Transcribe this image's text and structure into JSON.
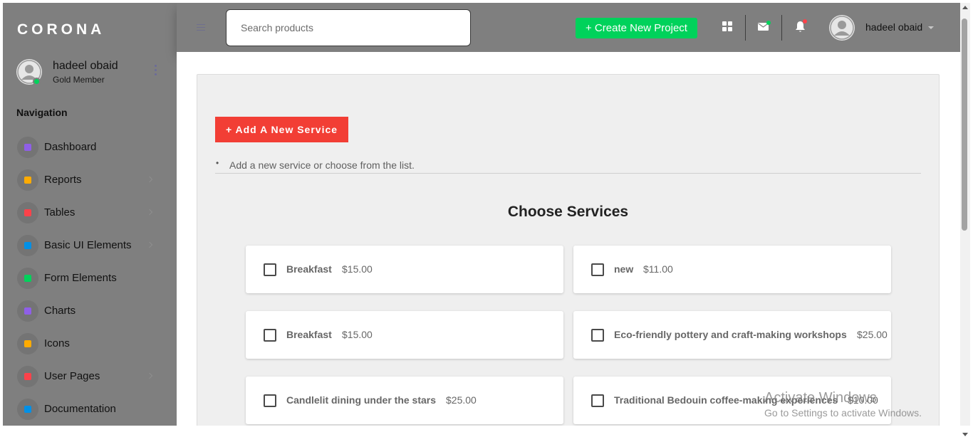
{
  "brand": "CORONA",
  "sidebar": {
    "username": "hadeel obaid",
    "role": "Gold Member",
    "nav_heading": "Navigation",
    "items": [
      {
        "label": "Dashboard",
        "icon": "speedometer-icon",
        "color": "#8f5fe8",
        "has_caret": false
      },
      {
        "label": "Reports",
        "icon": "bar-chart-icon",
        "color": "#ffab00",
        "has_caret": true
      },
      {
        "label": "Tables",
        "icon": "table-icon",
        "color": "#fc424a",
        "has_caret": true
      },
      {
        "label": "Basic UI Elements",
        "icon": "laptop-icon",
        "color": "#0090e7",
        "has_caret": true
      },
      {
        "label": "Form Elements",
        "icon": "playlist-icon",
        "color": "#00d25b",
        "has_caret": false
      },
      {
        "label": "Charts",
        "icon": "chart-icon",
        "color": "#8f5fe8",
        "has_caret": false
      },
      {
        "label": "Icons",
        "icon": "contacts-icon",
        "color": "#ffab00",
        "has_caret": false
      },
      {
        "label": "User Pages",
        "icon": "security-icon",
        "color": "#fc424a",
        "has_caret": true
      },
      {
        "label": "Documentation",
        "icon": "file-document-icon",
        "color": "#0090e7",
        "has_caret": false
      }
    ]
  },
  "topbar": {
    "search_placeholder": "Search products",
    "create_label": "+ Create New Project",
    "username": "hadeel obaid"
  },
  "main": {
    "add_label": "+ Add A New Service",
    "hint": "Add a new service or choose from the list.",
    "title": "Choose Services",
    "services": [
      {
        "name": "Breakfast",
        "price": "$15.00",
        "checked": false
      },
      {
        "name": "new",
        "price": "$11.00",
        "checked": false
      },
      {
        "name": "Breakfast",
        "price": "$15.00",
        "checked": false
      },
      {
        "name": "Eco-friendly pottery and craft-making workshops",
        "price": "$25.00",
        "checked": false
      },
      {
        "name": "Candlelit dining under the stars",
        "price": "$25.00",
        "checked": false
      },
      {
        "name": "Traditional Bedouin coffee-making experiences",
        "price": "$10.00",
        "checked": false
      }
    ]
  },
  "watermark": {
    "title": "Activate Windows",
    "subtitle": "Go to Settings to activate Windows."
  },
  "colors": {
    "accent_green": "#00d25b",
    "accent_red": "#f23e35",
    "sidebar_bg": "#7f7f7f"
  }
}
